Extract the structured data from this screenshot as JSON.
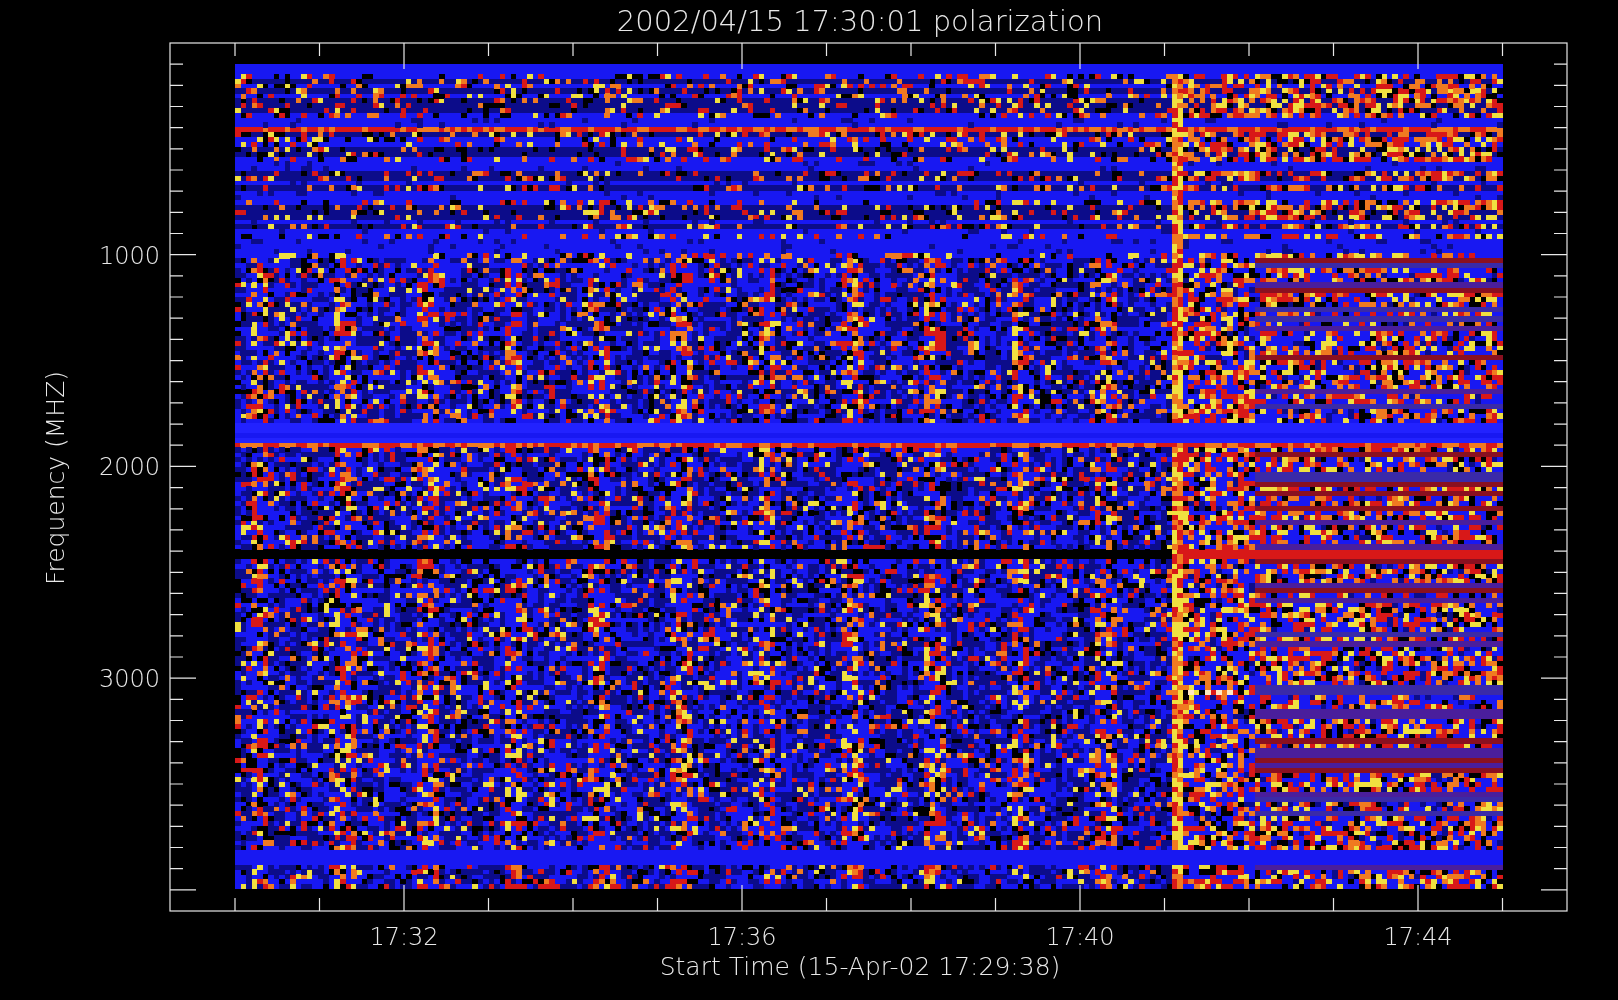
{
  "plot": {
    "title": "2002/04/15 17:30:01 polarization",
    "xlabel": "Start Time (15-Apr-02 17:29:38)",
    "ylabel": "Frequency (MHZ)",
    "x_tick_labels": [
      "17:32",
      "17:36",
      "17:40",
      "17:44"
    ],
    "y_tick_labels": [
      "1000",
      "2000",
      "3000"
    ]
  }
}
